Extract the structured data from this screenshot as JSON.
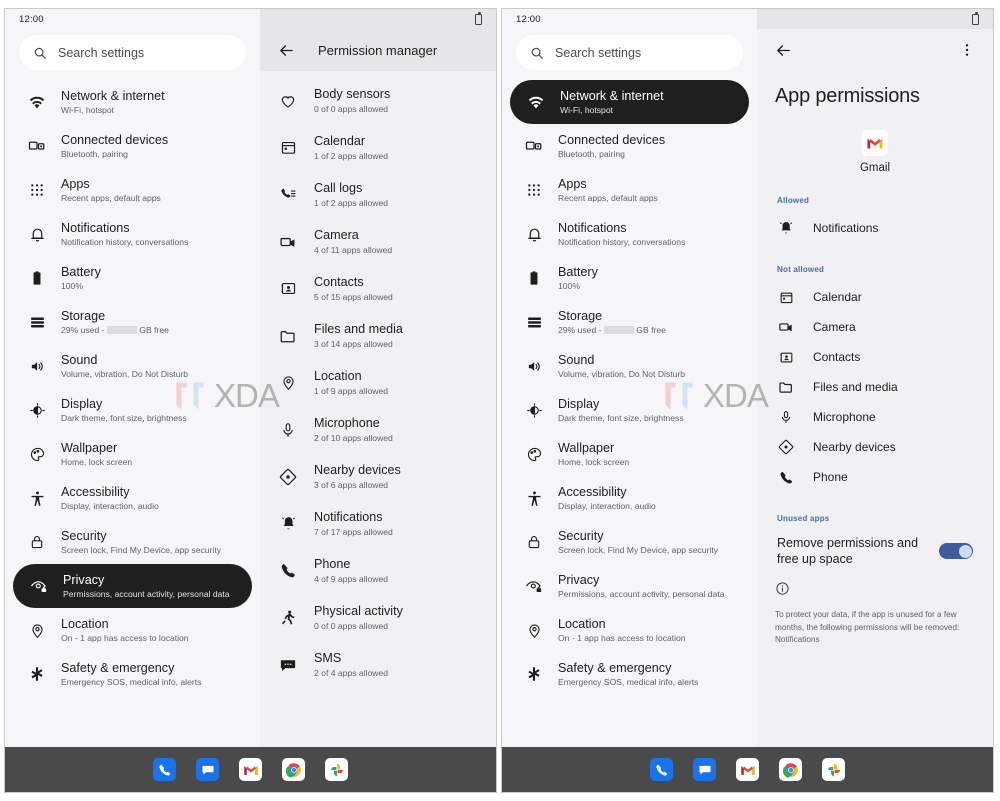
{
  "statusbar": {
    "time": "12:00",
    "battery_icon": "battery-icon"
  },
  "search": {
    "placeholder": "Search settings",
    "icon": "search-icon"
  },
  "settings_nav": {
    "items": [
      {
        "icon": "wifi-icon",
        "title": "Network & internet",
        "sub": "Wi-Fi, hotspot"
      },
      {
        "icon": "devices-icon",
        "title": "Connected devices",
        "sub": "Bluetooth, pairing"
      },
      {
        "icon": "apps-grid-icon",
        "title": "Apps",
        "sub": "Recent apps, default apps"
      },
      {
        "icon": "bell-icon",
        "title": "Notifications",
        "sub": "Notification history, conversations"
      },
      {
        "icon": "battery-icon",
        "title": "Battery",
        "sub": "100%"
      },
      {
        "icon": "storage-icon",
        "title": "Storage",
        "sub_prefix": "29% used -",
        "sub_suffix": "GB free",
        "redacted": true
      },
      {
        "icon": "volume-icon",
        "title": "Sound",
        "sub": "Volume, vibration, Do Not Disturb"
      },
      {
        "icon": "brightness-icon",
        "title": "Display",
        "sub": "Dark theme, font size, brightness"
      },
      {
        "icon": "palette-icon",
        "title": "Wallpaper",
        "sub": "Home, lock screen"
      },
      {
        "icon": "accessibility-icon",
        "title": "Accessibility",
        "sub": "Display, interaction, audio"
      },
      {
        "icon": "lock-icon",
        "title": "Security",
        "sub": "Screen lock, Find My Device, app security"
      },
      {
        "icon": "privacy-eye-icon",
        "title": "Privacy",
        "sub": "Permissions, account activity, personal data"
      },
      {
        "icon": "location-pin-icon",
        "title": "Location",
        "sub": "On - 1 app has access to location"
      },
      {
        "icon": "asterisk-icon",
        "title": "Safety & emergency",
        "sub": "Emergency SOS, medical info, alerts"
      }
    ],
    "selected_left": "Privacy",
    "selected_right": "Network & internet"
  },
  "permission_manager": {
    "back_icon": "back-arrow-icon",
    "title": "Permission manager",
    "items": [
      {
        "icon": "heart-icon",
        "title": "Body sensors",
        "sub": "0 of 0 apps allowed"
      },
      {
        "icon": "calendar-icon",
        "title": "Calendar",
        "sub": "1 of 2 apps allowed"
      },
      {
        "icon": "call-log-icon",
        "title": "Call logs",
        "sub": "1 of 2 apps allowed"
      },
      {
        "icon": "camera-icon",
        "title": "Camera",
        "sub": "4 of 11 apps allowed"
      },
      {
        "icon": "contacts-icon",
        "title": "Contacts",
        "sub": "5 of 15 apps allowed"
      },
      {
        "icon": "folder-icon",
        "title": "Files and media",
        "sub": "3 of 14 apps allowed"
      },
      {
        "icon": "location-pin-icon",
        "title": "Location",
        "sub": "1 of 9 apps allowed"
      },
      {
        "icon": "microphone-icon",
        "title": "Microphone",
        "sub": "2 of 10 apps allowed"
      },
      {
        "icon": "nearby-icon",
        "title": "Nearby devices",
        "sub": "3 of 6 apps allowed"
      },
      {
        "icon": "bell-ring-icon",
        "title": "Notifications",
        "sub": "7 of 17 apps allowed"
      },
      {
        "icon": "phone-icon",
        "title": "Phone",
        "sub": "4 of 9 apps allowed"
      },
      {
        "icon": "running-icon",
        "title": "Physical activity",
        "sub": "0 of 0 apps allowed"
      },
      {
        "icon": "sms-icon",
        "title": "SMS",
        "sub": "2 of 4 apps allowed"
      }
    ]
  },
  "app_permissions": {
    "back_icon": "back-arrow-icon",
    "overflow_icon": "more-vert-icon",
    "heading": "App permissions",
    "app_name": "Gmail",
    "app_icon": "gmail-icon",
    "allowed_label": "Allowed",
    "allowed": [
      {
        "icon": "bell-ring-icon",
        "label": "Notifications"
      }
    ],
    "not_allowed_label": "Not allowed",
    "not_allowed": [
      {
        "icon": "calendar-icon",
        "label": "Calendar"
      },
      {
        "icon": "camera-icon",
        "label": "Camera"
      },
      {
        "icon": "contacts-icon",
        "label": "Contacts"
      },
      {
        "icon": "folder-icon",
        "label": "Files and media"
      },
      {
        "icon": "microphone-icon",
        "label": "Microphone"
      },
      {
        "icon": "nearby-icon",
        "label": "Nearby devices"
      },
      {
        "icon": "phone-icon",
        "label": "Phone"
      }
    ],
    "unused_label": "Unused apps",
    "toggle_label": "Remove permissions and free up space",
    "toggle_on": true,
    "toggle_color": "#3f5d9e",
    "info_icon": "info-icon",
    "info_text": "To protect your data, if the app is unused for a few months, the following permissions will be removed: Notifications"
  },
  "dock": {
    "icons": [
      {
        "name": "phone-app-icon",
        "label": "Phone"
      },
      {
        "name": "messages-app-icon",
        "label": "Messages"
      },
      {
        "name": "gmail-app-icon",
        "label": "Gmail"
      },
      {
        "name": "chrome-app-icon",
        "label": "Chrome"
      },
      {
        "name": "photos-app-icon",
        "label": "Photos"
      }
    ]
  },
  "watermark": {
    "text": "XDA",
    "colors": {
      "pink": "#f3c9d3",
      "blue": "#cfe0f2",
      "gray": "#a9a9a9"
    }
  },
  "theme": {
    "selected_bg": "#1f1f1f",
    "nav_bg": "#f6f6f8",
    "detail_bg": "#f1f0f2",
    "toolbar_bg": "#e6e5e7",
    "dock_bg": "#4a4a4a",
    "section_blue": "#4a6fa5"
  }
}
